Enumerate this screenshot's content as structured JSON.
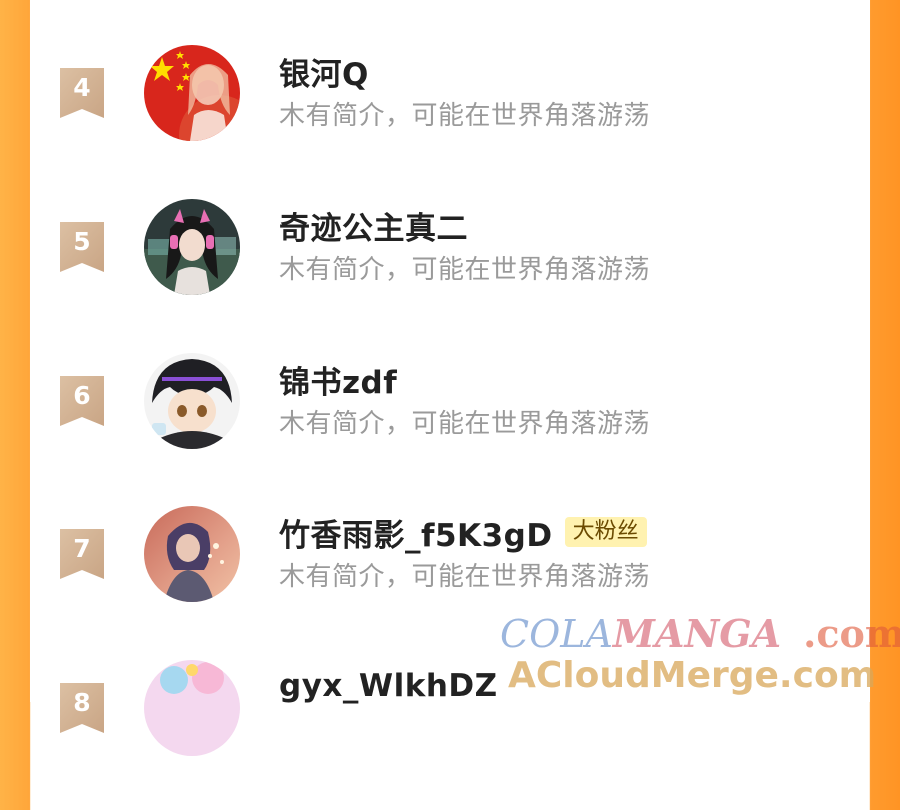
{
  "list": {
    "items": [
      {
        "rank": "4",
        "name": "银河Q",
        "badge": "",
        "bio": "木有简介，可能在世界角落游荡",
        "avatar": "flag-avatar"
      },
      {
        "rank": "5",
        "name": "奇迹公主真二",
        "badge": "",
        "bio": "木有简介，可能在世界角落游荡",
        "avatar": "headphone-girl-avatar"
      },
      {
        "rank": "6",
        "name": "锦书zdf",
        "badge": "",
        "bio": "木有简介，可能在世界角落游荡",
        "avatar": "anime-boy-avatar"
      },
      {
        "rank": "7",
        "name": "竹香雨影_f5K3gD",
        "badge": "大粉丝",
        "bio": "木有简介，可能在世界角落游荡",
        "avatar": "sunset-girl-avatar"
      },
      {
        "rank": "8",
        "name": "gyx_WlkhDZ",
        "badge": "",
        "bio": "",
        "avatar": "pastel-avatar"
      }
    ]
  },
  "watermark": {
    "cola": "COLA",
    "manga": "MANGA",
    "com": ".com",
    "line2": "ACloudMerge.com"
  },
  "colors": {
    "side_orange": "#ffa63a",
    "rank_ribbon": "#d9b99a",
    "badge_bg": "#fff2b0"
  }
}
